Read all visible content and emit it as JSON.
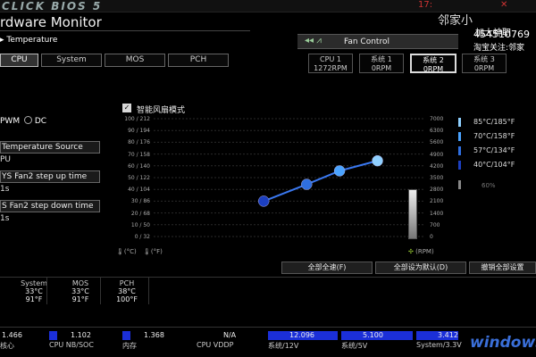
{
  "header": {
    "brand": "CLICK BIOS 5",
    "clock": "17:",
    "close": "✕",
    "title": "rdware Monitor"
  },
  "overlay": {
    "line1": "邻家小",
    "line2": "加大神职",
    "line3": "454510769",
    "line4": "淘宝关注:邻家"
  },
  "temperature": {
    "label": "Temperature",
    "tabs": [
      "CPU",
      "System",
      "MOS",
      "PCH"
    ],
    "selected": 0
  },
  "fan_control": {
    "label": "Fan Control",
    "fans": [
      {
        "name": "CPU 1",
        "rpm": "1272RPM"
      },
      {
        "name": "系统 1",
        "rpm": "0RPM"
      },
      {
        "name": "系统 2",
        "rpm": "0RPM"
      },
      {
        "name": "系统 3",
        "rpm": "0RPM"
      }
    ],
    "selected": 2
  },
  "left": {
    "pwm": "PWM",
    "dc": "DC",
    "temp_source_label": "Temperature Source",
    "temp_source_value": "PU",
    "stepup_label": "YS Fan2 step up time",
    "stepup_value": "1s",
    "stepdown_label": "S Fan2 step down time",
    "stepdown_value": "1s"
  },
  "chart": {
    "smart_mode_label": "智能风扇模式",
    "check": "✓",
    "yleft_ticks": [
      "100 / 212",
      "90 / 194",
      "80 / 176",
      "70 / 158",
      "60 / 140",
      "50 / 122",
      "40 / 104",
      "30 / 86",
      "20 / 68",
      "10 / 50",
      "0 / 32"
    ],
    "yright_ticks": [
      "7000",
      "6300",
      "5600",
      "4900",
      "4200",
      "3500",
      "2800",
      "2100",
      "1400",
      "700",
      "0"
    ],
    "unit_c": "(°C)",
    "unit_f": "(°F)",
    "unit_rpm": "(RPM)",
    "thresholds": [
      {
        "text": "85°C/185°F",
        "color": "#8fd0ff"
      },
      {
        "text": "70°C/158°F",
        "color": "#4aa3ff"
      },
      {
        "text": "57°C/134°F",
        "color": "#2f6fe0"
      },
      {
        "text": "40°C/104°F",
        "color": "#1c3fc0"
      }
    ],
    "percent": "60%"
  },
  "chart_data": {
    "type": "line",
    "title": "",
    "xlabel": "",
    "ylabel": "",
    "x": [
      40,
      57,
      70,
      85
    ],
    "y": [
      2100,
      3100,
      3900,
      4500
    ],
    "ylim": [
      0,
      7000
    ],
    "xlim": [
      0,
      100
    ]
  },
  "actions": {
    "full_speed": "全部全速(F)",
    "default": "全部设为默认(D)",
    "cancel": "撤销全部设置"
  },
  "readings": [
    {
      "label": "System",
      "c": "33°C",
      "f": "91°F"
    },
    {
      "label": "MOS",
      "c": "33°C",
      "f": "91°F"
    },
    {
      "label": "PCH",
      "c": "38°C",
      "f": "100°F"
    }
  ],
  "voltages": [
    {
      "value": "1.466",
      "label": "核心",
      "fill": 0
    },
    {
      "value": "1.102",
      "label": "CPU NB/SOC",
      "fill": 0.12
    },
    {
      "value": "1.368",
      "label": "内存",
      "fill": 0.12
    },
    {
      "value": "N/A",
      "label": "CPU VDDP",
      "fill": 0
    },
    {
      "value": "12.096",
      "label": "系统/12V",
      "fill": 1
    },
    {
      "value": "5.100",
      "label": "系统/5V",
      "fill": 1
    },
    {
      "value": "3.412",
      "label": "System/3.3V",
      "fill": 0.6
    }
  ],
  "watermark": "windows"
}
